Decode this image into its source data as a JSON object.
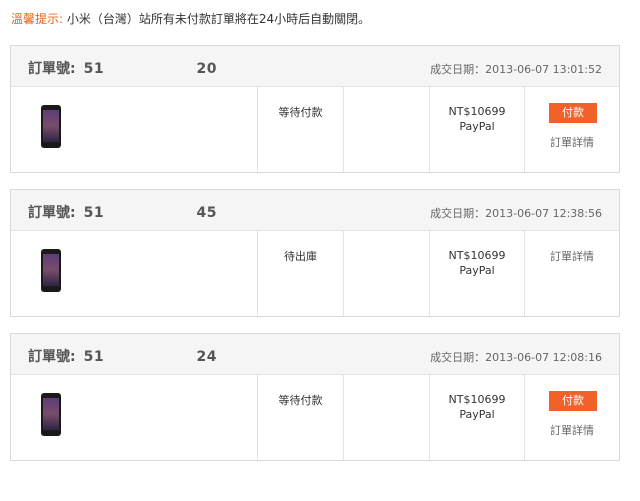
{
  "notice": {
    "label": "溫馨提示:",
    "text": "小米（台灣）站所有未付款訂單將在24小時后自動關閉。"
  },
  "colors": {
    "accent": "#f0622a",
    "notice_label": "#e8641b"
  },
  "order_label": "訂單號:",
  "orders": [
    {
      "number": "51　　　　　　 20",
      "date": "成交日期：2013-06-07 13:01:52",
      "status": "等待付款",
      "price": "NT$10699",
      "payment": "PayPal",
      "pay_button": "付款",
      "detail_link": "訂單詳情"
    },
    {
      "number": "51　　　　　　 45",
      "date": "成交日期：2013-06-07 12:38:56",
      "status": "待出庫",
      "price": "NT$10699",
      "payment": "PayPal",
      "detail_link": "訂單詳情"
    },
    {
      "number": "51　　　　　　 24",
      "date": "成交日期：2013-06-07 12:08:16",
      "status": "等待付款",
      "price": "NT$10699",
      "payment": "PayPal",
      "pay_button": "付款",
      "detail_link": "訂單詳情"
    }
  ]
}
